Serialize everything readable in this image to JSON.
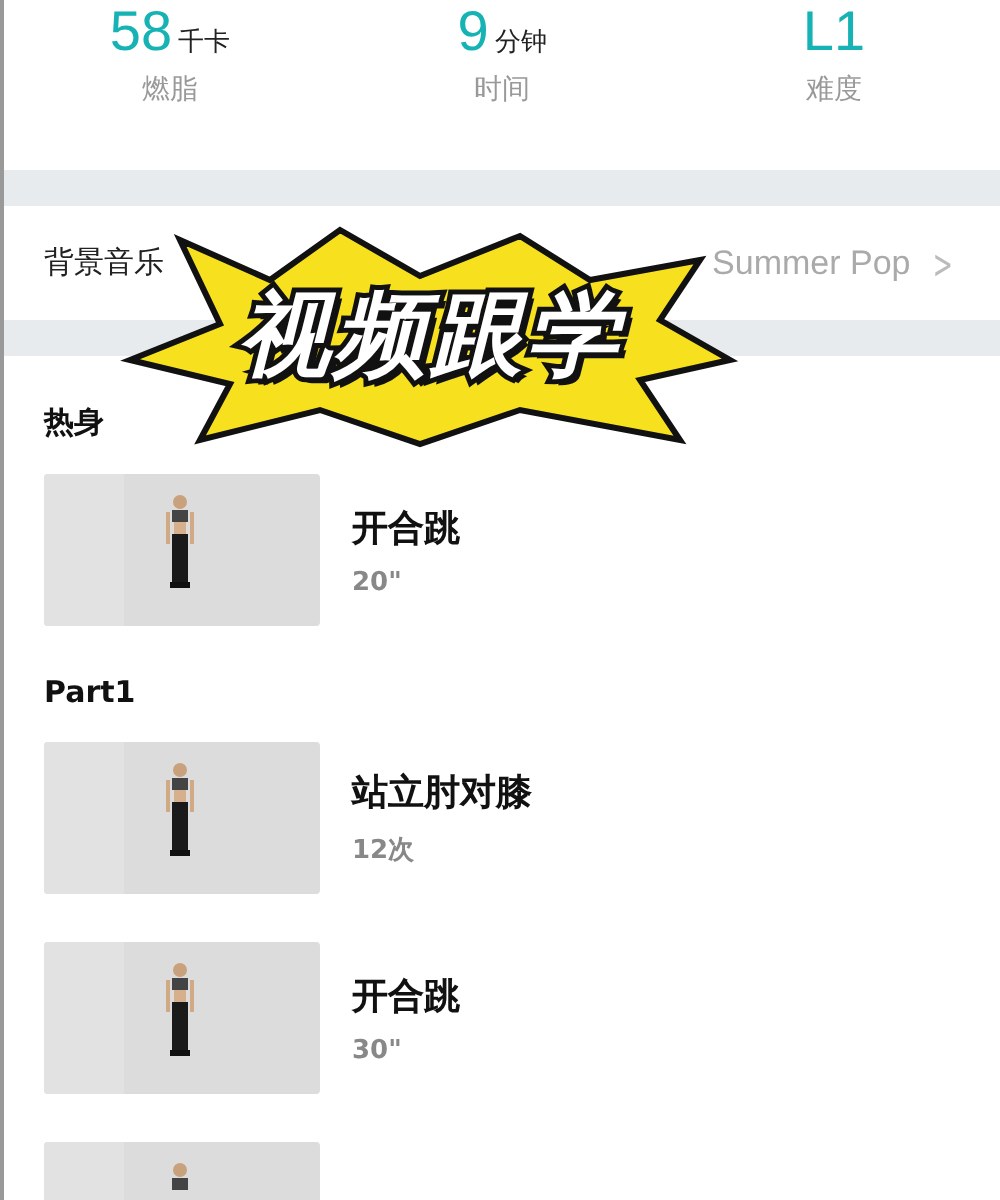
{
  "stats": [
    {
      "value": "58",
      "unit": "千卡",
      "label": "燃脂"
    },
    {
      "value": "9",
      "unit": "分钟",
      "label": "时间"
    },
    {
      "value": "L1",
      "label": "难度"
    }
  ],
  "music": {
    "label": "背景音乐",
    "value": "Summer Pop",
    "chevron": ">"
  },
  "sections": [
    {
      "title": "热身",
      "items": [
        {
          "name": "开合跳",
          "amount": "20\""
        }
      ]
    },
    {
      "title": "Part1",
      "items": [
        {
          "name": "站立肘对膝",
          "amount": "12次"
        },
        {
          "name": "开合跳",
          "amount": "30\""
        }
      ]
    }
  ],
  "sticker": {
    "text": "视频跟学"
  }
}
